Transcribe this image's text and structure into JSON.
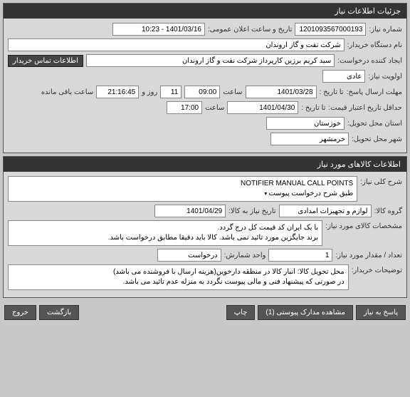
{
  "panel1": {
    "title": "جزئیات اطلاعات نیاز",
    "need_number_label": "شماره نیاز:",
    "need_number": "1201093567000193",
    "public_announce_label": "تاریخ و ساعت اعلان عمومی:",
    "public_announce": "1401/03/16 - 10:23",
    "buyer_org_label": "نام دستگاه خریدار:",
    "buyer_org": "شرکت نفت و گاز اروندان",
    "creator_label": "ایجاد کننده درخواست:",
    "creator": "سید کریم برزین کارپرداز شرکت نفت و گاز اروندان",
    "buyer_contact_btn": "اطلاعات تماس خریدار",
    "priority_label": "اولویت نیاز:",
    "priority": "عادی",
    "reply_deadline_label": "مهلت ارسال پاسخ:",
    "to_date_label": "تا تاریخ :",
    "reply_date": "1401/03/28",
    "time_label": "ساعت",
    "reply_time": "09:00",
    "days_count": "11",
    "days_and": "روز و",
    "remaining_time": "21:16:45",
    "remaining_label": "ساعت باقی مانده",
    "price_validity_label": "حداقل تاریخ اعتبار قیمت:",
    "price_validity_date": "1401/04/30",
    "price_validity_time": "17:00",
    "delivery_province_label": "استان محل تحویل:",
    "delivery_province": "خوزستان",
    "delivery_city_label": "شهر محل تحویل:",
    "delivery_city": "خرمشهر"
  },
  "panel2": {
    "title": "اطلاعات کالاهای مورد نیاز",
    "need_desc_label": "شرح کلی نیاز:",
    "need_desc": "NOTIFIER MANUAL CALL POINTS\nطبق شرح درخواست پیوست",
    "goods_group_label": "گروه کالا:",
    "goods_group": "لوازم و تجهیزات امدادی",
    "need_to_goods_date_label": "تاریخ نیاز به کالا:",
    "need_to_goods_date": "1401/04/29",
    "goods_spec_label": "مشخصات کالای مورد نیاز:",
    "goods_spec": "با یک ایران کد قیمت کل درج گردد.\nبرند جایگزین مورد تائید نمی باشد. کالا باید دقیقا مطابق درخواست باشد.",
    "qty_label": "تعداد / مقدار مورد نیاز:",
    "qty": "1",
    "unit_label": "واحد شمارش:",
    "unit": "درخواست",
    "buyer_notes_label": "توضیحات خریدار:",
    "buyer_notes": "محل تحویل کالا: انبار کالا در منطقه دارخوین(هزینه ارسال با فروشنده می باشد)\nدر صورتی که پیشنهاد فنی و مالی پیوست نگردد به منزله عدم تائید می باشد."
  },
  "footer": {
    "reply": "پاسخ به نیاز",
    "attachments": "مشاهده مدارک پیوستی (1)",
    "print": "چاپ",
    "back": "بازگشت",
    "exit": "خروج"
  }
}
